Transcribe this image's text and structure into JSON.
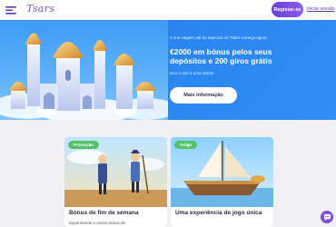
{
  "header": {
    "logo_text": "Tsars",
    "register_label": "Registar-se",
    "login_label": "Iniciar sessão"
  },
  "hero": {
    "eyebrow": "A sua viagem até às riquezas do Tsars começa agora",
    "title": "€2000 em bónus pelos seus depósitos e 200 giros grátis",
    "subtitle": "Isso é que é uma oferta!",
    "cta_label": "Mais informação"
  },
  "cards": [
    {
      "tag": "Promoção",
      "title": "Bónus de fim de semana",
      "desc": "Experimente o nosso bónus de"
    },
    {
      "tag": "Artigo",
      "title": "Uma experiência de jogo única",
      "desc": ""
    }
  ],
  "colors": {
    "brand": "#7a55c9",
    "hero_blue": "#2a85f0",
    "tag_promo": "#53c26a",
    "chat": "#7b4fe0"
  },
  "icons": {
    "menu": "menu-icon",
    "chat": "chat-icon"
  }
}
